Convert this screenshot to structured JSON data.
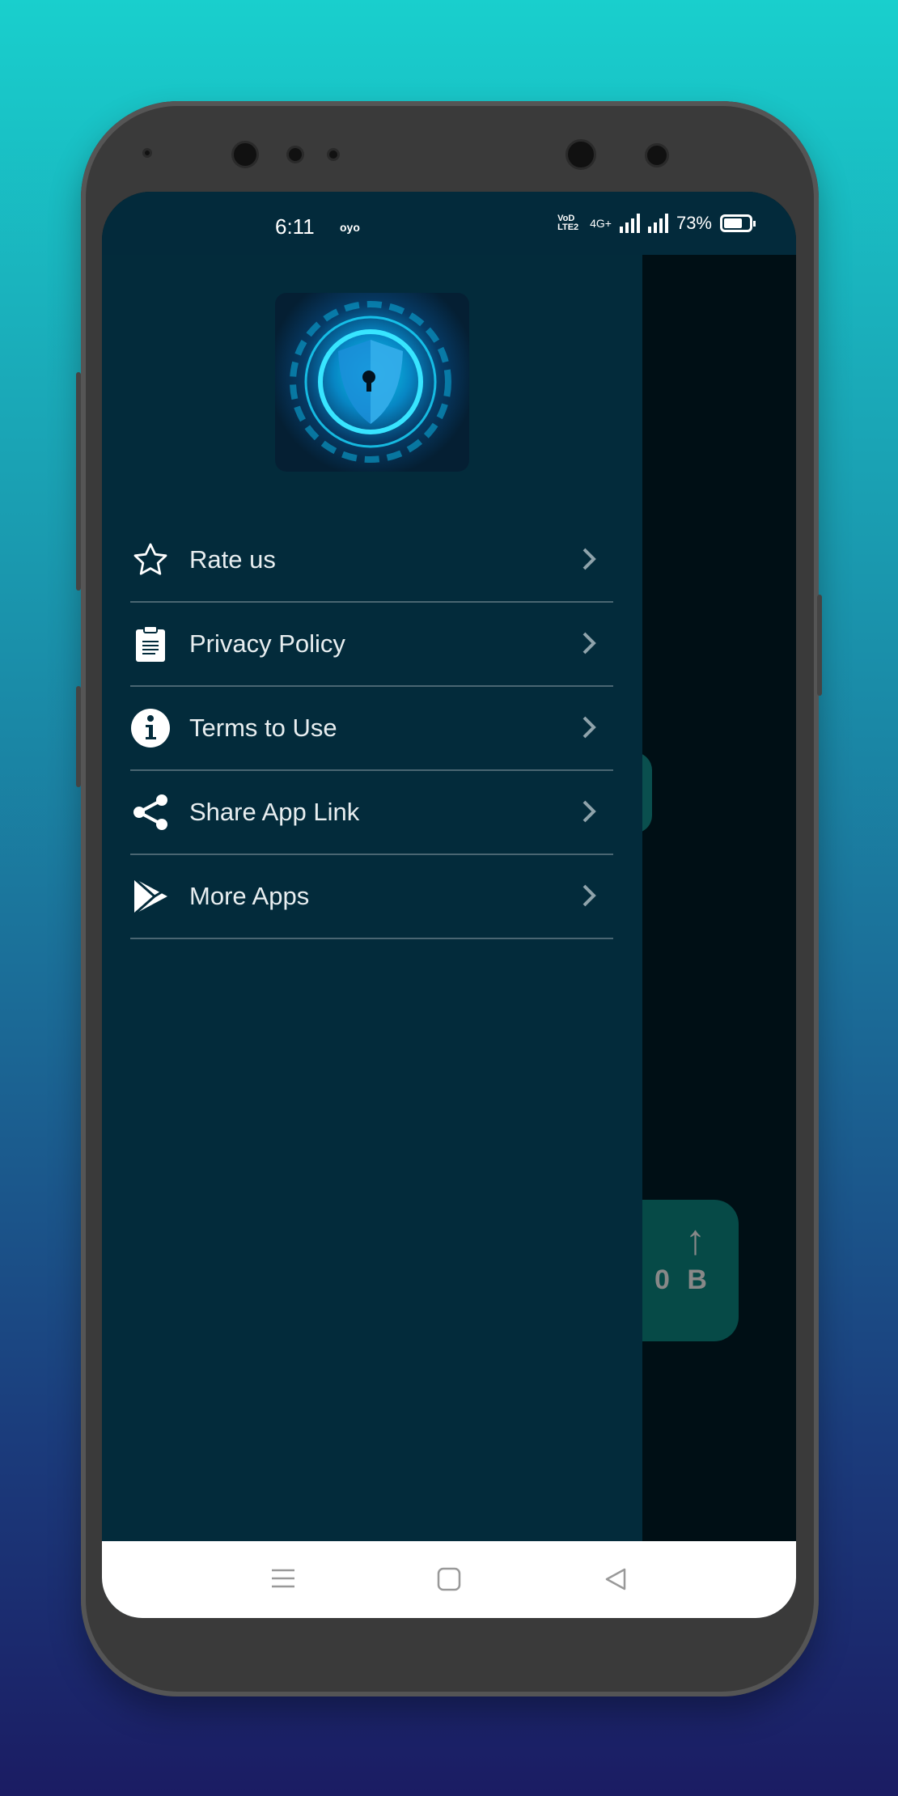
{
  "status_bar": {
    "time": "6:11",
    "carrier_icon": "oyo",
    "network_label": "VoD LTE2",
    "network_type": "4G+",
    "battery": "73%",
    "battery_level": 0.73
  },
  "background_app": {
    "speed_value": "0 B",
    "upload_icon": "arrow-up-icon"
  },
  "drawer": {
    "logo": "shield-lock-logo",
    "items": [
      {
        "label": "Rate us",
        "icon": "star-icon"
      },
      {
        "label": "Privacy Policy",
        "icon": "clipboard-icon"
      },
      {
        "label": "Terms to Use",
        "icon": "info-icon"
      },
      {
        "label": "Share App Link",
        "icon": "share-icon"
      },
      {
        "label": "More Apps",
        "icon": "play-store-icon"
      }
    ]
  },
  "colors": {
    "drawer_bg": "#032b3b",
    "divider": "#4a6672",
    "accent": "#0a4f4e"
  }
}
